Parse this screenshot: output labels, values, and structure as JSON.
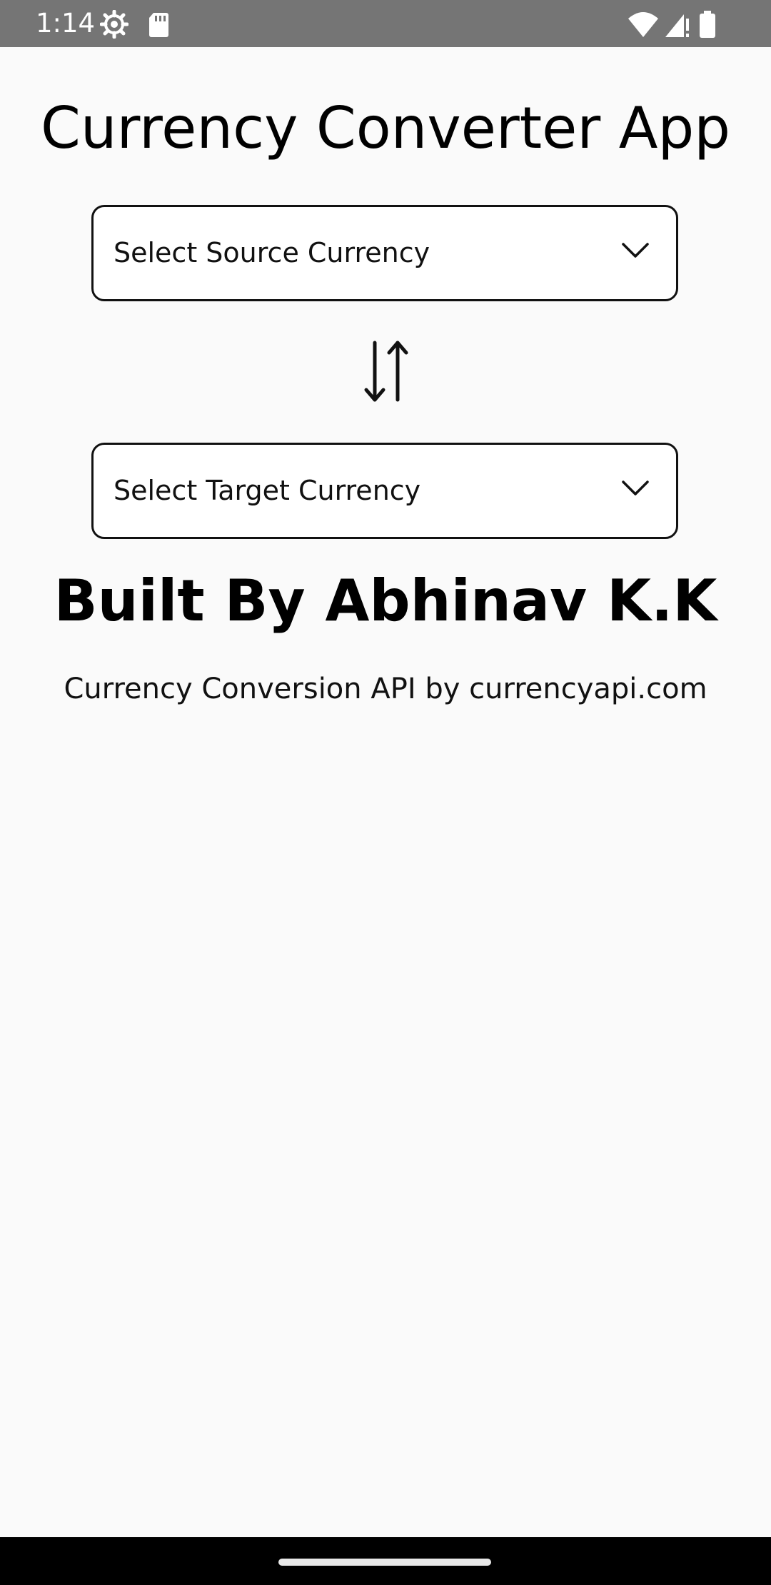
{
  "status_bar": {
    "time": "1:14",
    "icons": [
      "settings-gear-icon",
      "sd-card-icon",
      "wifi-icon",
      "cell-signal-icon",
      "battery-icon"
    ]
  },
  "app": {
    "title": "Currency Converter App"
  },
  "source_dropdown": {
    "label": "Select Source Currency",
    "icon": "chevron-down-icon"
  },
  "swap": {
    "icon": "swap-vertical-arrows-icon"
  },
  "target_dropdown": {
    "label": "Select Target Currency",
    "icon": "chevron-down-icon"
  },
  "footer": {
    "built_by": "Built By Abhinav K.K",
    "api_credit": "Currency Conversion API by currencyapi.com"
  },
  "colors": {
    "status_bar": "#757575",
    "background": "#fafafa",
    "nav_bar": "#000000",
    "text": "#000000"
  }
}
